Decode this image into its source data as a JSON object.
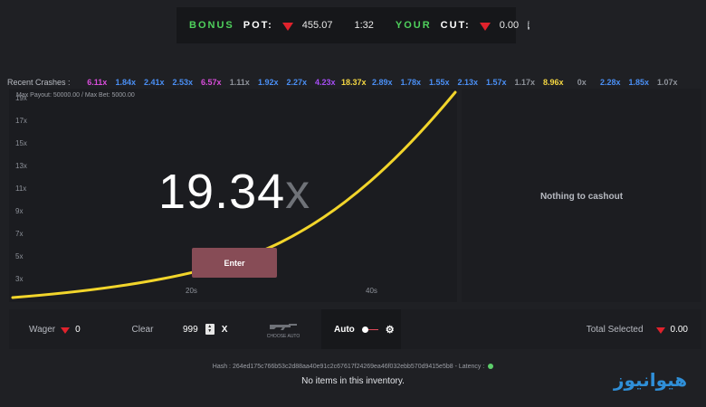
{
  "bonus": {
    "pot_label": "BONUS",
    "pot_label2": "POT:",
    "pot_value": "455.07",
    "timer": "1:32",
    "cut_label": "YOUR",
    "cut_label2": "CUT:",
    "cut_value": "0.00",
    "info_icon": "i"
  },
  "recent": {
    "label": "Recent Crashes :",
    "items": [
      {
        "value": "6.11x",
        "color": "#d94ddb"
      },
      {
        "value": "1.84x",
        "color": "#4a8ff5"
      },
      {
        "value": "2.41x",
        "color": "#4a8ff5"
      },
      {
        "value": "2.53x",
        "color": "#4a8ff5"
      },
      {
        "value": "6.57x",
        "color": "#d94ddb"
      },
      {
        "value": "1.11x",
        "color": "#8e929a"
      },
      {
        "value": "1.92x",
        "color": "#4a8ff5"
      },
      {
        "value": "2.27x",
        "color": "#4a8ff5"
      },
      {
        "value": "4.23x",
        "color": "#a64df5"
      },
      {
        "value": "18.37x",
        "color": "#f5d742"
      },
      {
        "value": "2.89x",
        "color": "#4a8ff5"
      },
      {
        "value": "1.78x",
        "color": "#4a8ff5"
      },
      {
        "value": "1.55x",
        "color": "#4a8ff5"
      },
      {
        "value": "2.13x",
        "color": "#4a8ff5"
      },
      {
        "value": "1.57x",
        "color": "#4a8ff5"
      },
      {
        "value": "1.17x",
        "color": "#8e929a"
      },
      {
        "value": "8.96x",
        "color": "#f5d742"
      },
      {
        "value": "0x",
        "color": "#8e929a"
      },
      {
        "value": "2.28x",
        "color": "#4a8ff5"
      },
      {
        "value": "1.85x",
        "color": "#4a8ff5"
      },
      {
        "value": "1.07x",
        "color": "#8e929a"
      }
    ]
  },
  "game": {
    "limits": "Max Payout: 50000.00 / Max Bet: 5000.00",
    "y_ticks": [
      "19x",
      "17x",
      "15x",
      "13x",
      "11x",
      "9x",
      "7x",
      "5x",
      "3x"
    ],
    "x_ticks": [
      "20s",
      "40s"
    ],
    "multiplier": "19.34",
    "multiplier_suffix": "x",
    "enter_label": "Enter",
    "curve_color": "#f2d52b"
  },
  "side": {
    "empty_text": "Nothing to cashout"
  },
  "controls": {
    "wager_label": "Wager",
    "wager_value": "0",
    "clear_label": "Clear",
    "amount_value": "999",
    "mult_suffix": "X",
    "choose_auto_label": "CHOOSE AUTO",
    "auto_label": "Auto",
    "total_label": "Total Selected",
    "total_value": "0.00"
  },
  "footer": {
    "hash": "Hash : 264ed175c766b53c2d88aa40e91c2c67617f24269ea46f032ebb570d9415e5b8 - Latency :",
    "empty_inventory": "No items in this inventory.",
    "watermark": "هیوانیوز"
  }
}
